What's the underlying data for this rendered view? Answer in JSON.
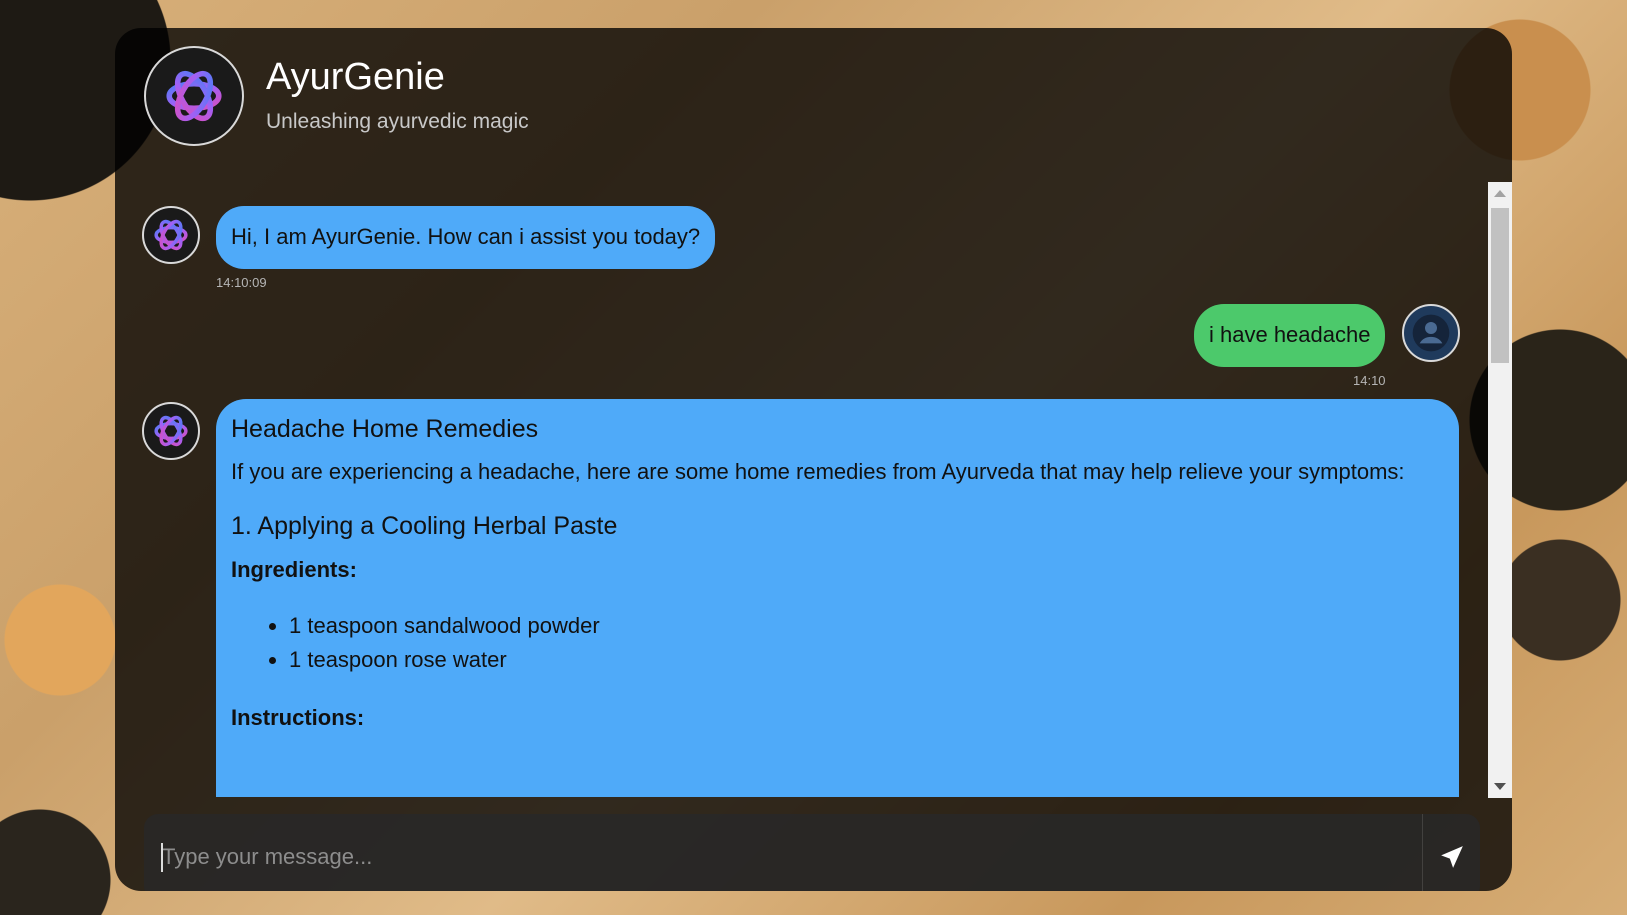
{
  "app": {
    "title": "AyurGenie",
    "subtitle": "Unleashing ayurvedic magic",
    "logo_icon": "openai-knot-icon"
  },
  "colors": {
    "bot_bubble": "#4faaf9",
    "user_bubble": "#4cc96b",
    "card_bg": "rgba(0,0,0,0.78)"
  },
  "messages": [
    {
      "sender": "bot",
      "text": "Hi, I am AyurGenie. How can i assist you today?",
      "time": "14:10:09"
    },
    {
      "sender": "user",
      "text": "i have headache",
      "time": "14:10",
      "avatar_icon": "user-circle-icon"
    },
    {
      "sender": "bot",
      "heading": "Headache Home Remedies",
      "intro": "If you are experiencing a headache, here are some home remedies from Ayurveda that may help relieve your symptoms:",
      "section_title": "1. Applying a Cooling Herbal Paste",
      "ingredients_label": "Ingredients:",
      "ingredients": [
        "1 teaspoon sandalwood powder",
        "1 teaspoon rose water"
      ],
      "instructions_label": "Instructions:"
    }
  ],
  "composer": {
    "placeholder": "Type your message...",
    "send_icon": "send-plane-icon"
  }
}
